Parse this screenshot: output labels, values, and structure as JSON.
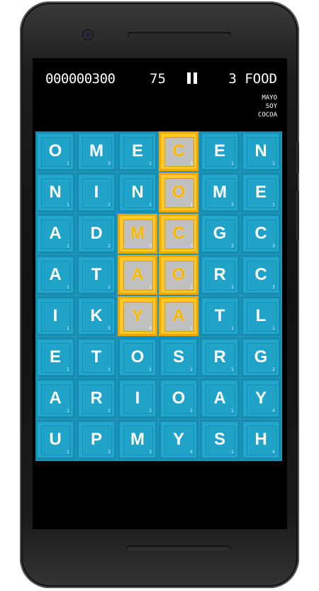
{
  "hud": {
    "score": "000000300",
    "moves": "75",
    "topic": "3 FOOD",
    "words": [
      "MAYO",
      "SOY",
      "COCOA"
    ]
  },
  "colors": {
    "tile": "#21a7cd",
    "tile_border": "#178cb0",
    "selected_tile": "#ffc72c",
    "screen_bg": "#000000"
  },
  "icons": [
    "pause-icon",
    "camera-icon",
    "speaker-icon"
  ],
  "board": {
    "rows": 8,
    "cols": 6,
    "tiles": [
      [
        {
          "l": "O",
          "p": "1"
        },
        {
          "l": "M",
          "p": "3"
        },
        {
          "l": "E",
          "p": "1"
        },
        {
          "l": "C",
          "p": "3",
          "sel": true
        },
        {
          "l": "E",
          "p": "1"
        },
        {
          "l": "N",
          "p": "1"
        }
      ],
      [
        {
          "l": "N",
          "p": "1"
        },
        {
          "l": "I",
          "p": "1"
        },
        {
          "l": "N",
          "p": "1"
        },
        {
          "l": "O",
          "p": "1",
          "sel": true
        },
        {
          "l": "M",
          "p": "3"
        },
        {
          "l": "E",
          "p": "1"
        }
      ],
      [
        {
          "l": "A",
          "p": "1"
        },
        {
          "l": "D",
          "p": "2"
        },
        {
          "l": "M",
          "p": "3",
          "sel": true
        },
        {
          "l": "C",
          "p": "3",
          "sel": true
        },
        {
          "l": "G",
          "p": "2"
        },
        {
          "l": "C",
          "p": "3"
        }
      ],
      [
        {
          "l": "A",
          "p": "1"
        },
        {
          "l": "T",
          "p": "1"
        },
        {
          "l": "A",
          "p": "1",
          "sel": true
        },
        {
          "l": "O",
          "p": "1",
          "sel": true
        },
        {
          "l": "R",
          "p": "1"
        },
        {
          "l": "C",
          "p": "3"
        }
      ],
      [
        {
          "l": "I",
          "p": "1"
        },
        {
          "l": "K",
          "p": "5"
        },
        {
          "l": "Y",
          "p": "4",
          "sel": true
        },
        {
          "l": "A",
          "p": "1",
          "sel": true
        },
        {
          "l": "T",
          "p": "1"
        },
        {
          "l": "L",
          "p": "1"
        }
      ],
      [
        {
          "l": "E",
          "p": "1"
        },
        {
          "l": "T",
          "p": "1"
        },
        {
          "l": "O",
          "p": "1"
        },
        {
          "l": "S",
          "p": "1"
        },
        {
          "l": "R",
          "p": "1"
        },
        {
          "l": "G",
          "p": "2"
        }
      ],
      [
        {
          "l": "A",
          "p": "1"
        },
        {
          "l": "R",
          "p": "1"
        },
        {
          "l": "I",
          "p": "1"
        },
        {
          "l": "O",
          "p": "1"
        },
        {
          "l": "A",
          "p": "1"
        },
        {
          "l": "Y",
          "p": "4"
        }
      ],
      [
        {
          "l": "U",
          "p": "1"
        },
        {
          "l": "P",
          "p": "3"
        },
        {
          "l": "M",
          "p": "3"
        },
        {
          "l": "Y",
          "p": "4"
        },
        {
          "l": "S",
          "p": "1"
        },
        {
          "l": "H",
          "p": "4"
        }
      ]
    ]
  }
}
